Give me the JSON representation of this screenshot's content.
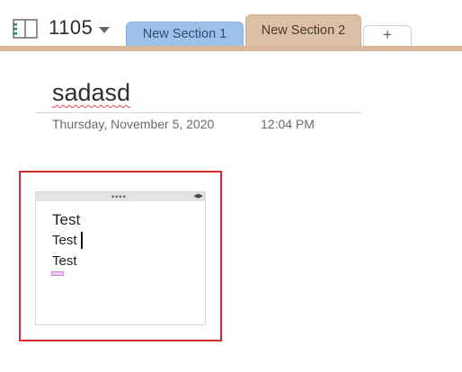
{
  "notebook": {
    "name": "1105"
  },
  "tabs": [
    {
      "label": "New Section 1",
      "color": "#9cc1ea"
    },
    {
      "label": "New Section 2",
      "color": "#dcbfa7",
      "active": true
    },
    {
      "label": "+"
    }
  ],
  "page": {
    "title": "sadasd",
    "date": "Thursday, November 5, 2020",
    "time": "12:04 PM"
  },
  "note": {
    "lines": [
      "Test",
      "Test",
      "Test"
    ]
  },
  "icons": {
    "notebook": "notebook-icon",
    "caret": "chevron-down-icon",
    "grip": "move-handle-icon",
    "resize": "resize-arrows-icon"
  },
  "colors": {
    "highlight_border": "#d42b2b",
    "section_strip": "#d8b79c",
    "spellcheck": "#e0464c"
  }
}
